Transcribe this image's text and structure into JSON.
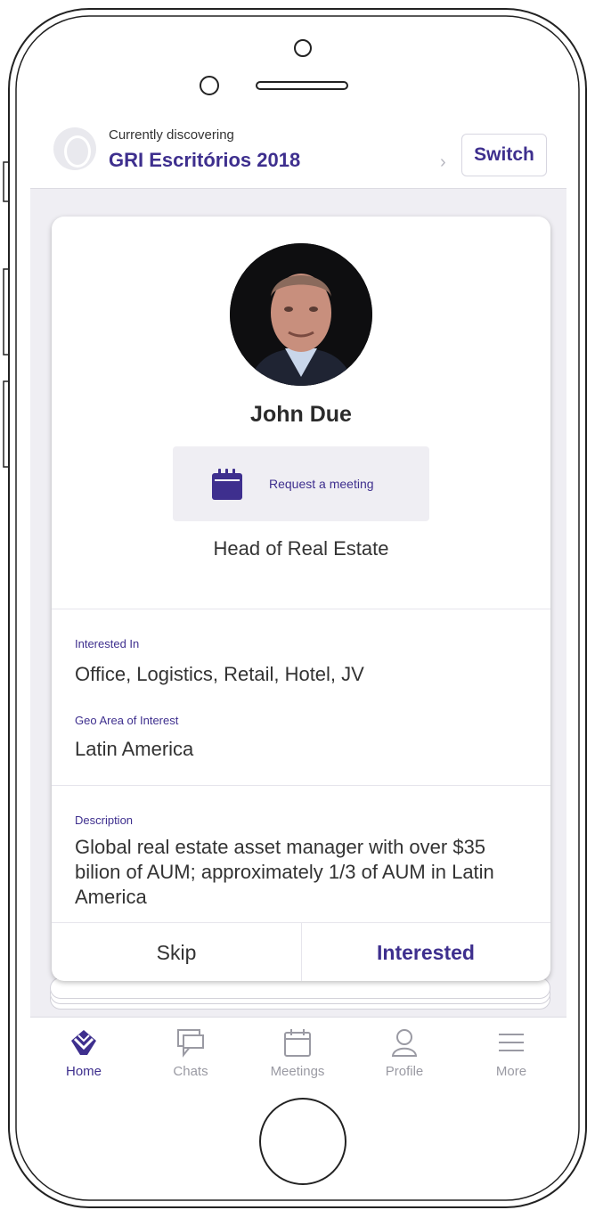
{
  "header": {
    "label": "Currently discovering",
    "event": "GRI Escritórios 2018",
    "switch_label": "Switch"
  },
  "profile": {
    "name": "John Due",
    "request_meeting": "Request a meeting",
    "job_title": "Head of Real Estate",
    "interested_label": "Interested In",
    "interested_value": "Office, Logistics, Retail, Hotel, JV",
    "geo_label": "Geo Area of Interest",
    "geo_value": "Latin America",
    "description_label": "Description",
    "description_value": "Global real estate asset manager with over $35 bilion of AUM; approximately 1/3 of AUM in Latin America"
  },
  "actions": {
    "skip": "Skip",
    "interested": "Interested"
  },
  "tabs": [
    {
      "label": "Home",
      "icon": "home-icon",
      "active": true
    },
    {
      "label": "Chats",
      "icon": "chat-icon",
      "active": false
    },
    {
      "label": "Meetings",
      "icon": "calendar-icon",
      "active": false
    },
    {
      "label": "Profile",
      "icon": "profile-icon",
      "active": false
    },
    {
      "label": "More",
      "icon": "menu-icon",
      "active": false
    }
  ],
  "colors": {
    "accent": "#3e2f8e",
    "background": "#efeef3",
    "inactive": "#9a9aa3"
  }
}
